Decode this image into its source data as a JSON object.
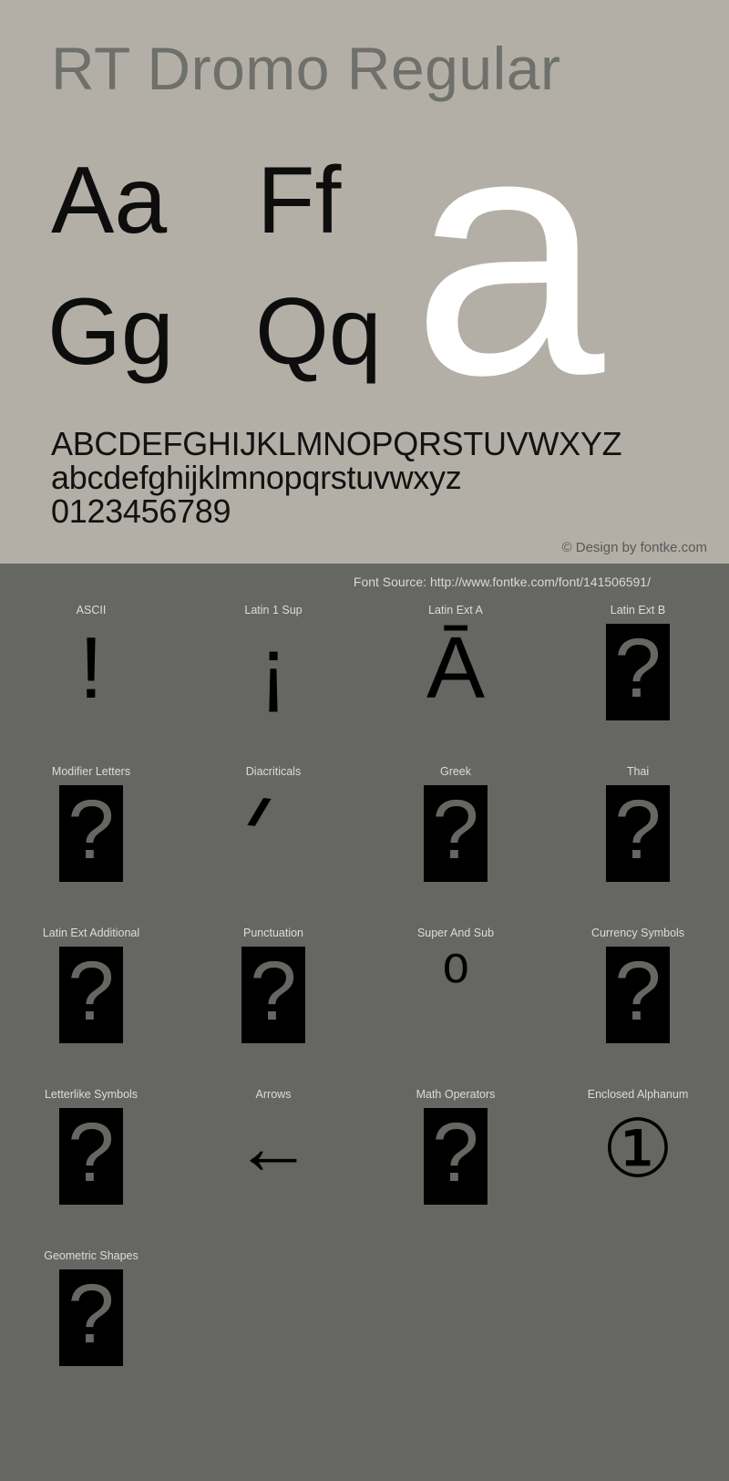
{
  "specimen": {
    "title": "RT Dromo Regular",
    "glyph_pairs": [
      "Aa",
      "Ff",
      "Gg",
      "Qq"
    ],
    "feature_letter": "a",
    "alphabet": {
      "uppercase": "ABCDEFGHIJKLMNOPQRSTUVWXYZ",
      "lowercase": "abcdefghijklmnopqrstuvwxyz",
      "digits": "0123456789"
    },
    "credit": "© Design by fontke.com"
  },
  "coverage": {
    "source": "Font Source: http://www.fontke.com/font/141506591/",
    "blocks": [
      {
        "label": "ASCII",
        "glyph": "!",
        "kind": "glyph"
      },
      {
        "label": "Latin 1 Sup",
        "glyph": "¡",
        "kind": "glyph"
      },
      {
        "label": "Latin Ext A",
        "glyph": "Ā",
        "kind": "glyph"
      },
      {
        "label": "Latin Ext B",
        "glyph": "",
        "kind": "tofu"
      },
      {
        "label": "Modifier Letters",
        "glyph": "",
        "kind": "tofu"
      },
      {
        "label": "Diacriticals",
        "glyph": "",
        "kind": "grave"
      },
      {
        "label": "Greek",
        "glyph": "",
        "kind": "tofu"
      },
      {
        "label": "Thai",
        "glyph": "",
        "kind": "tofu"
      },
      {
        "label": "Latin Ext Additional",
        "glyph": "",
        "kind": "tofu"
      },
      {
        "label": "Punctuation",
        "glyph": "",
        "kind": "tofu"
      },
      {
        "label": "Super And Sub",
        "glyph": "⁰",
        "kind": "glyph"
      },
      {
        "label": "Currency Symbols",
        "glyph": "",
        "kind": "tofu"
      },
      {
        "label": "Letterlike Symbols",
        "glyph": "",
        "kind": "tofu"
      },
      {
        "label": "Arrows",
        "glyph": "←",
        "kind": "arrow"
      },
      {
        "label": "Math Operators",
        "glyph": "",
        "kind": "tofu"
      },
      {
        "label": "Enclosed Alphanum",
        "glyph": "①",
        "kind": "circled"
      },
      {
        "label": "Geometric Shapes",
        "glyph": "",
        "kind": "tofu"
      }
    ]
  },
  "colors": {
    "specimen_background": "#b3afa6",
    "coverage_background": "#666663",
    "title": "#6f6f6b",
    "glyph_black": "#0d0d0d",
    "feature_letter": "#ffffff",
    "label": "#dedcd7",
    "credit": "#59585a"
  }
}
